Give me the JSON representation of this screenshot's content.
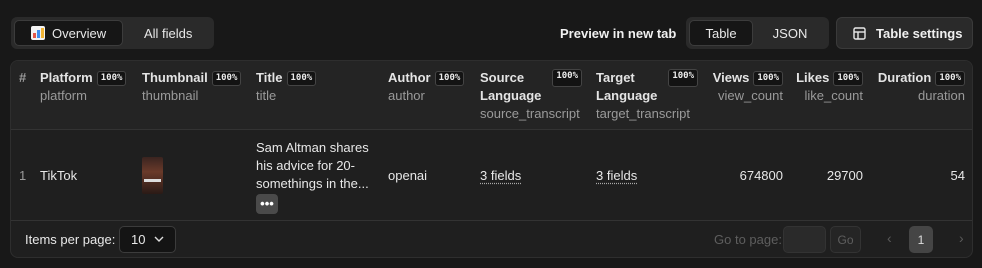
{
  "toolbar": {
    "view_tabs": [
      {
        "label": "Overview",
        "icon": "chart-icon",
        "active": true
      },
      {
        "label": "All fields",
        "active": false
      }
    ],
    "preview_label": "Preview in new tab",
    "format_tabs": [
      {
        "label": "Table",
        "active": true
      },
      {
        "label": "JSON",
        "active": false
      }
    ],
    "settings_label": "Table settings",
    "settings_icon": "table-settings-icon"
  },
  "table": {
    "index_header": "#",
    "columns": [
      {
        "name": "Platform",
        "key": "platform",
        "fill": "100%"
      },
      {
        "name": "Thumbnail",
        "key": "thumbnail",
        "fill": "100%"
      },
      {
        "name": "Title",
        "key": "title",
        "fill": "100%"
      },
      {
        "name": "Author",
        "key": "author",
        "fill": "100%"
      },
      {
        "name": "Source Language",
        "name_l1": "Source",
        "name_l2": "Language",
        "key": "source_transcript",
        "fill": "100%"
      },
      {
        "name": "Target Language",
        "name_l1": "Target",
        "name_l2": "Language",
        "key": "target_transcript",
        "fill": "100%"
      },
      {
        "name": "Views",
        "key": "view_count",
        "fill": "100%"
      },
      {
        "name": "Likes",
        "key": "like_count",
        "fill": "100%"
      },
      {
        "name": "Duration",
        "key": "duration",
        "fill": "100%"
      }
    ],
    "rows": [
      {
        "index": "1",
        "platform": "TikTok",
        "title_lines": [
          "Sam Altman shares",
          "his advice for 20-",
          "somethings in the..."
        ],
        "author": "openai",
        "source_transcript": "3 fields",
        "target_transcript": "3 fields",
        "view_count": "674800",
        "like_count": "29700",
        "duration": "54"
      }
    ]
  },
  "footer": {
    "items_per_page_label": "Items per page:",
    "items_per_page_value": "10",
    "goto_label": "Go to page:",
    "go_button": "Go",
    "current_page": "1"
  }
}
